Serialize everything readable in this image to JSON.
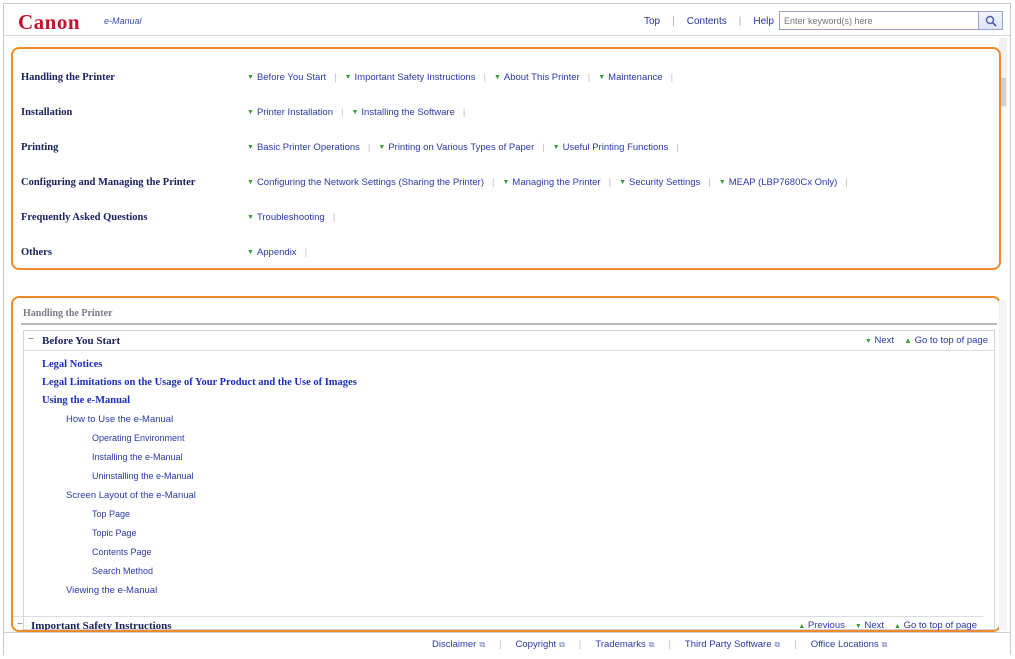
{
  "header": {
    "logo": "Canon",
    "product": "e-Manual",
    "links": [
      "Top",
      "Contents",
      "Help"
    ],
    "search_placeholder": "Enter keyword(s) here"
  },
  "categories": [
    {
      "name": "Handling the Printer",
      "links": [
        "Before You Start",
        "Important Safety Instructions",
        "About This Printer",
        "Maintenance"
      ]
    },
    {
      "name": "Installation",
      "links": [
        "Printer Installation",
        "Installing the Software"
      ]
    },
    {
      "name": "Printing",
      "links": [
        "Basic Printer Operations",
        "Printing on Various Types of Paper",
        "Useful Printing Functions"
      ]
    },
    {
      "name": "Configuring and Managing the Printer",
      "links": [
        "Configuring the Network Settings (Sharing the Printer)",
        "Managing the Printer",
        "Security Settings",
        "MEAP (LBP7680Cx Only)"
      ]
    },
    {
      "name": "Frequently Asked Questions",
      "links": [
        "Troubleshooting"
      ]
    },
    {
      "name": "Others",
      "links": [
        "Appendix"
      ]
    }
  ],
  "content": {
    "section_title": "Handling the Printer",
    "panel_title": "Before You Start",
    "nav": {
      "next": "Next",
      "top": "Go to top of page",
      "previous": "Previous"
    },
    "toc": [
      {
        "text": "Legal Notices",
        "level": 1
      },
      {
        "text": "Legal Limitations on the Usage of Your Product and the Use of Images",
        "level": 1
      },
      {
        "text": "Using the e-Manual",
        "level": 1
      },
      {
        "text": "How to Use the e-Manual",
        "level": 2
      },
      {
        "text": "Operating Environment",
        "level": 3
      },
      {
        "text": "Installing the e-Manual",
        "level": 3
      },
      {
        "text": "Uninstalling the e-Manual",
        "level": 3
      },
      {
        "text": "Screen Layout of the e-Manual",
        "level": 2
      },
      {
        "text": "Top Page",
        "level": 3
      },
      {
        "text": "Topic Page",
        "level": 3
      },
      {
        "text": "Contents Page",
        "level": 3
      },
      {
        "text": "Search Method",
        "level": 3
      },
      {
        "text": "Viewing the e-Manual",
        "level": 2
      }
    ],
    "next_panel_title": "Important Safety Instructions"
  },
  "footer": {
    "links": [
      "Disclaimer",
      "Copyright",
      "Trademarks",
      "Third Party Software",
      "Office Locations"
    ]
  },
  "colors": {
    "accent_outline": "#ef8a2a",
    "logo": "#c8102e",
    "link": "#2a3aa8"
  }
}
